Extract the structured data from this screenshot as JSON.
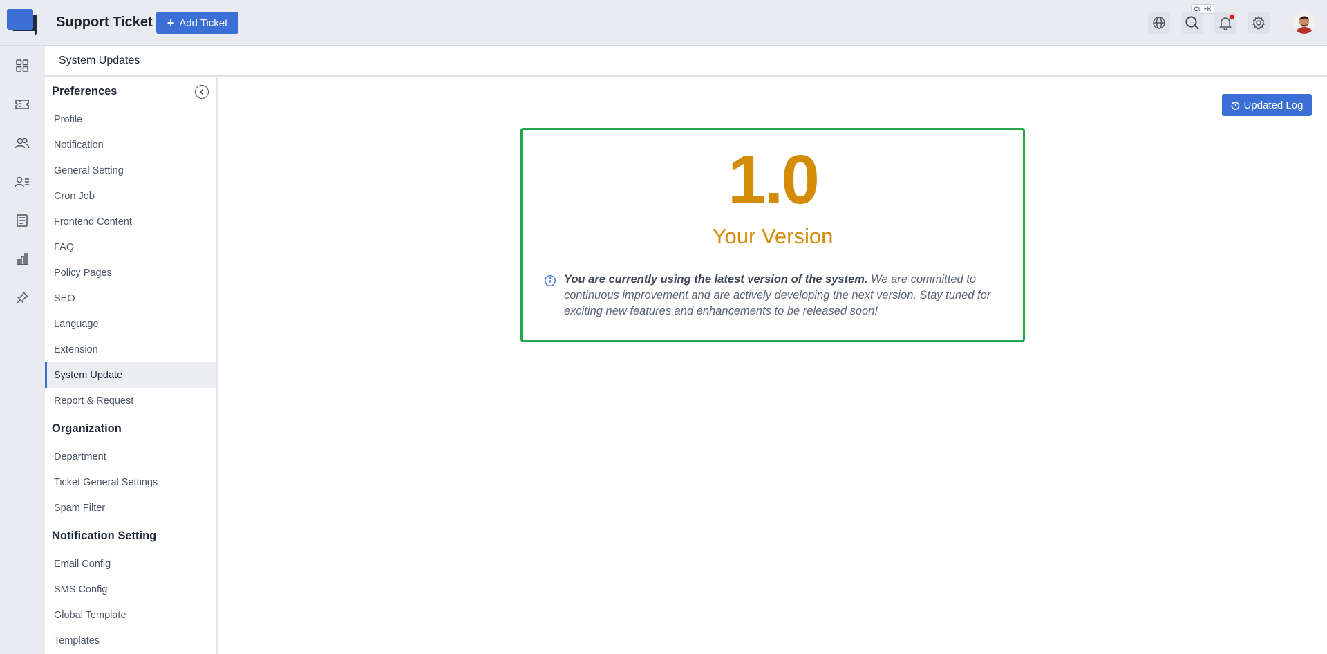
{
  "app": {
    "title": "Support Ticket",
    "add_ticket_label": "Add Ticket",
    "search_shortcut": "Ctrl+K",
    "accent_color": "#3b6fd6"
  },
  "top_icons": [
    "globe-icon",
    "search-icon",
    "bell-icon",
    "gear-icon",
    "avatar"
  ],
  "rail_icons": [
    "dashboard-icon",
    "ticket-icon",
    "users-icon",
    "user-list-icon",
    "document-icon",
    "chart-icon",
    "pin-icon"
  ],
  "page": {
    "title": "System Updates"
  },
  "sidebar": {
    "groups": [
      {
        "title": "Preferences",
        "items": [
          "Profile",
          "Notification",
          "General Setting",
          "Cron Job",
          "Frontend Content",
          "FAQ",
          "Policy Pages",
          "SEO",
          "Language",
          "Extension",
          "System Update",
          "Report & Request"
        ]
      },
      {
        "title": "Organization",
        "items": [
          "Department",
          "Ticket General Settings",
          "Spam Filter"
        ]
      },
      {
        "title": "Notification Setting",
        "items": [
          "Email Config",
          "SMS Config",
          "Global Template",
          "Templates"
        ]
      }
    ],
    "active_item": "System Update"
  },
  "main": {
    "updated_log_label": "Updated Log",
    "version_number": "1.0",
    "version_label": "Your Version",
    "message_bold": "You are currently using the latest version of the system.",
    "message_rest": " We are committed to continuous improvement and are actively developing the next version. Stay tuned for exciting new features and enhancements to be released soon!",
    "version_color": "#d48b07",
    "card_border_color": "#22a74a"
  }
}
